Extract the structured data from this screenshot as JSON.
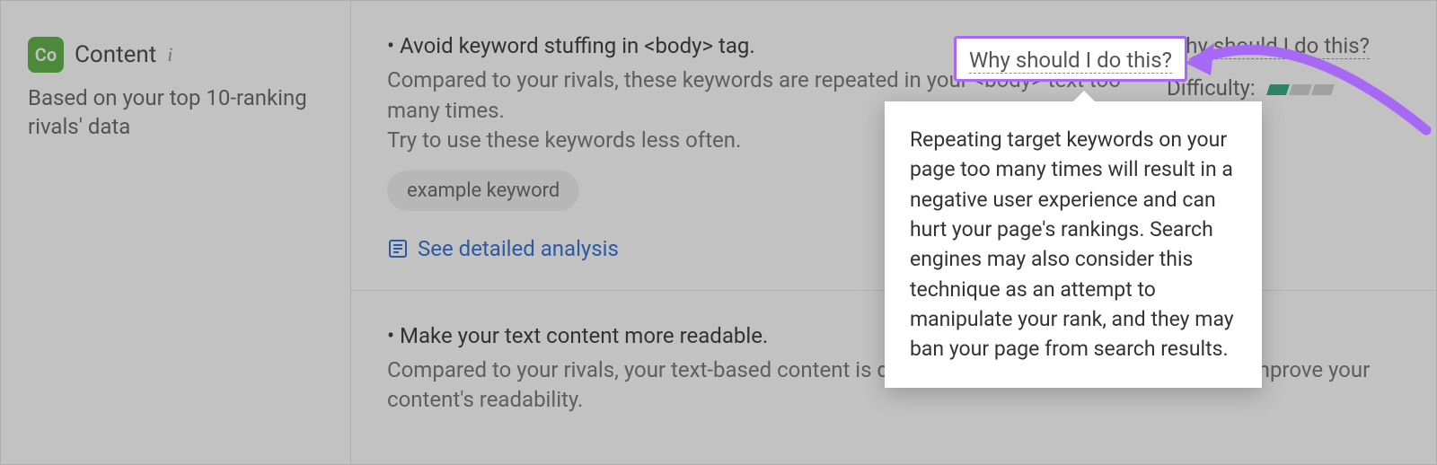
{
  "section": {
    "badge": "Co",
    "title": "Content",
    "subtitle": "Based on your top 10-ranking rivals' data"
  },
  "recs": [
    {
      "title": "• Avoid keyword stuffing in <body> tag.",
      "desc": "Compared to your rivals, these keywords are repeated in your <body> text too many times.\nTry to use these keywords less often.",
      "chip": "example keyword",
      "link": "See detailed analysis",
      "why": "Why should I do this?",
      "difficulty_label": "Difficulty:"
    },
    {
      "title": "• Make your text content more readable.",
      "desc": "Compared to your rivals, your text-based content is difficult to read and understand. Try to improve your content's readability."
    }
  ],
  "tooltip": "Repeating target keywords on your page too many times will result in a negative user experience and can hurt your page's rankings. Search engines may also consider this technique as an attempt to manipulate your rank, and they may ban your page from search results."
}
